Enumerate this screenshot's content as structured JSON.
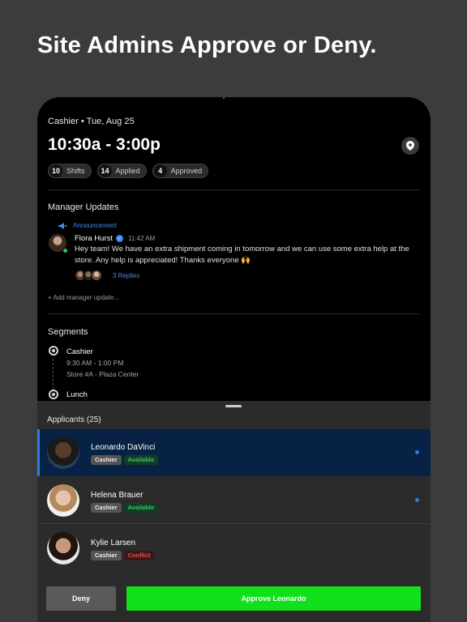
{
  "headline": "Site Admins Approve or Deny.",
  "shift": {
    "subtitle": "Cashier • Tue, Aug 25",
    "time": "10:30a - 3:00p",
    "stats": [
      {
        "count": "10",
        "label": "Shifts"
      },
      {
        "count": "14",
        "label": "Applied"
      },
      {
        "count": "4",
        "label": "Approved"
      }
    ]
  },
  "manager_updates": {
    "title": "Manager Updates",
    "announcement_label": "Announcement",
    "author": "Flora Hurst",
    "timestamp": "11:42 AM",
    "message": "Hey team! We have an extra shipment coming in tomorrow and we can use some extra help at the store. Any help is appreciated! Thanks everyone 🙌",
    "replies_label": "3 Replies",
    "add_update": "+ Add manager update..."
  },
  "segments": {
    "title": "Segments",
    "items": [
      {
        "name": "Cashier",
        "time": "9:30 AM - 1:00 PM",
        "location": "Store #A - Plaza Center"
      },
      {
        "name": "Lunch"
      }
    ]
  },
  "applicants": {
    "title": "Applicants (25)",
    "list": [
      {
        "name": "Leonardo DaVinci",
        "role": "Cashier",
        "status": "Available",
        "unread": true,
        "selected": true
      },
      {
        "name": "Helena Brauer",
        "role": "Cashier",
        "status": "Available",
        "unread": true,
        "selected": false
      },
      {
        "name": "Kylie Larsen",
        "role": "Cashier",
        "status": "Conflict",
        "unread": false,
        "selected": false
      }
    ]
  },
  "actions": {
    "deny": "Deny",
    "approve": "Approve Leonardo"
  },
  "colors": {
    "accent_blue": "#2f7de0",
    "approve_green": "#11e01a",
    "available_green": "#35c46a",
    "conflict_red": "#e0504f"
  }
}
